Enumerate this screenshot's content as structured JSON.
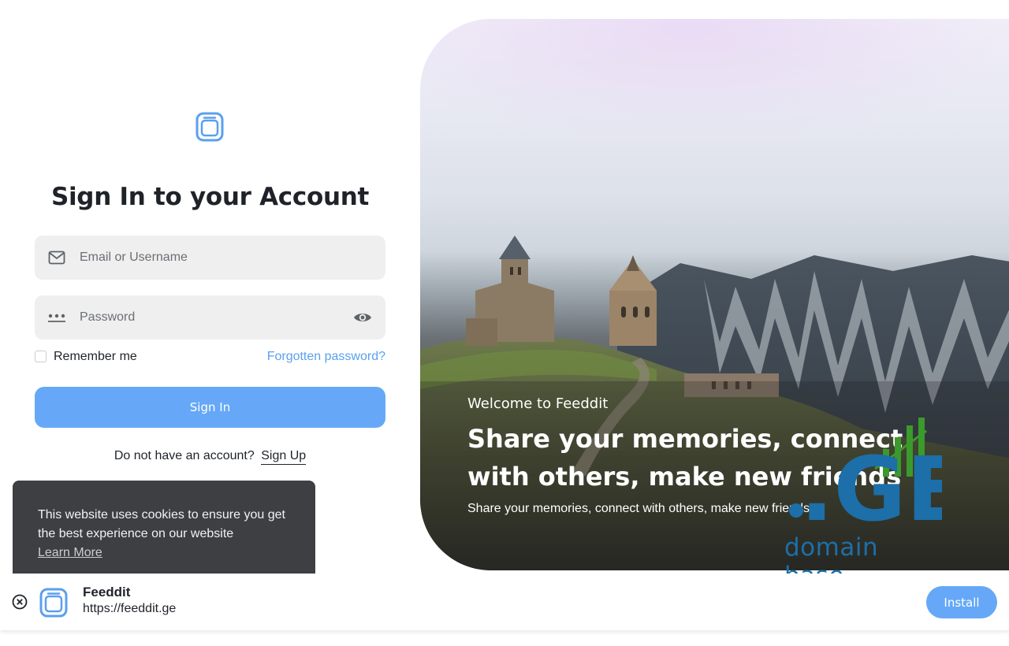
{
  "colors": {
    "accent": "#66a8f7",
    "link": "#5aa0ee",
    "input_bg": "#efefef",
    "cookie_bg": "#3d3f42"
  },
  "login": {
    "logo_icon": "app-logo-icon",
    "title": "Sign In to your Account",
    "email": {
      "icon": "mail-icon",
      "placeholder": "Email or Username",
      "value": ""
    },
    "password": {
      "icon": "password-dots-icon",
      "placeholder": "Password",
      "value": "",
      "toggle_icon": "eye-icon"
    },
    "remember_label": "Remember me",
    "remember_checked": false,
    "forgot_label": "Forgotten password?",
    "signin_label": "Sign In",
    "signup_prompt": "Do not have an account?",
    "signup_link": "Sign Up"
  },
  "cookie": {
    "message": "This website uses cookies to ensure you get the best experience on our website",
    "learn_more": "Learn More"
  },
  "hero": {
    "welcome": "Welcome to Feeddit",
    "headline": "Share your memories, connect with others, make new friends",
    "subtitle": "Share your memories, connect with others, make new friends",
    "watermark_mark": ".GE",
    "watermark_text": "domain base"
  },
  "install_bar": {
    "close_icon": "close-circle-icon",
    "app_icon": "app-logo-icon",
    "app_name": "Feeddit",
    "app_url": "https://feeddit.ge",
    "install_label": "Install"
  }
}
